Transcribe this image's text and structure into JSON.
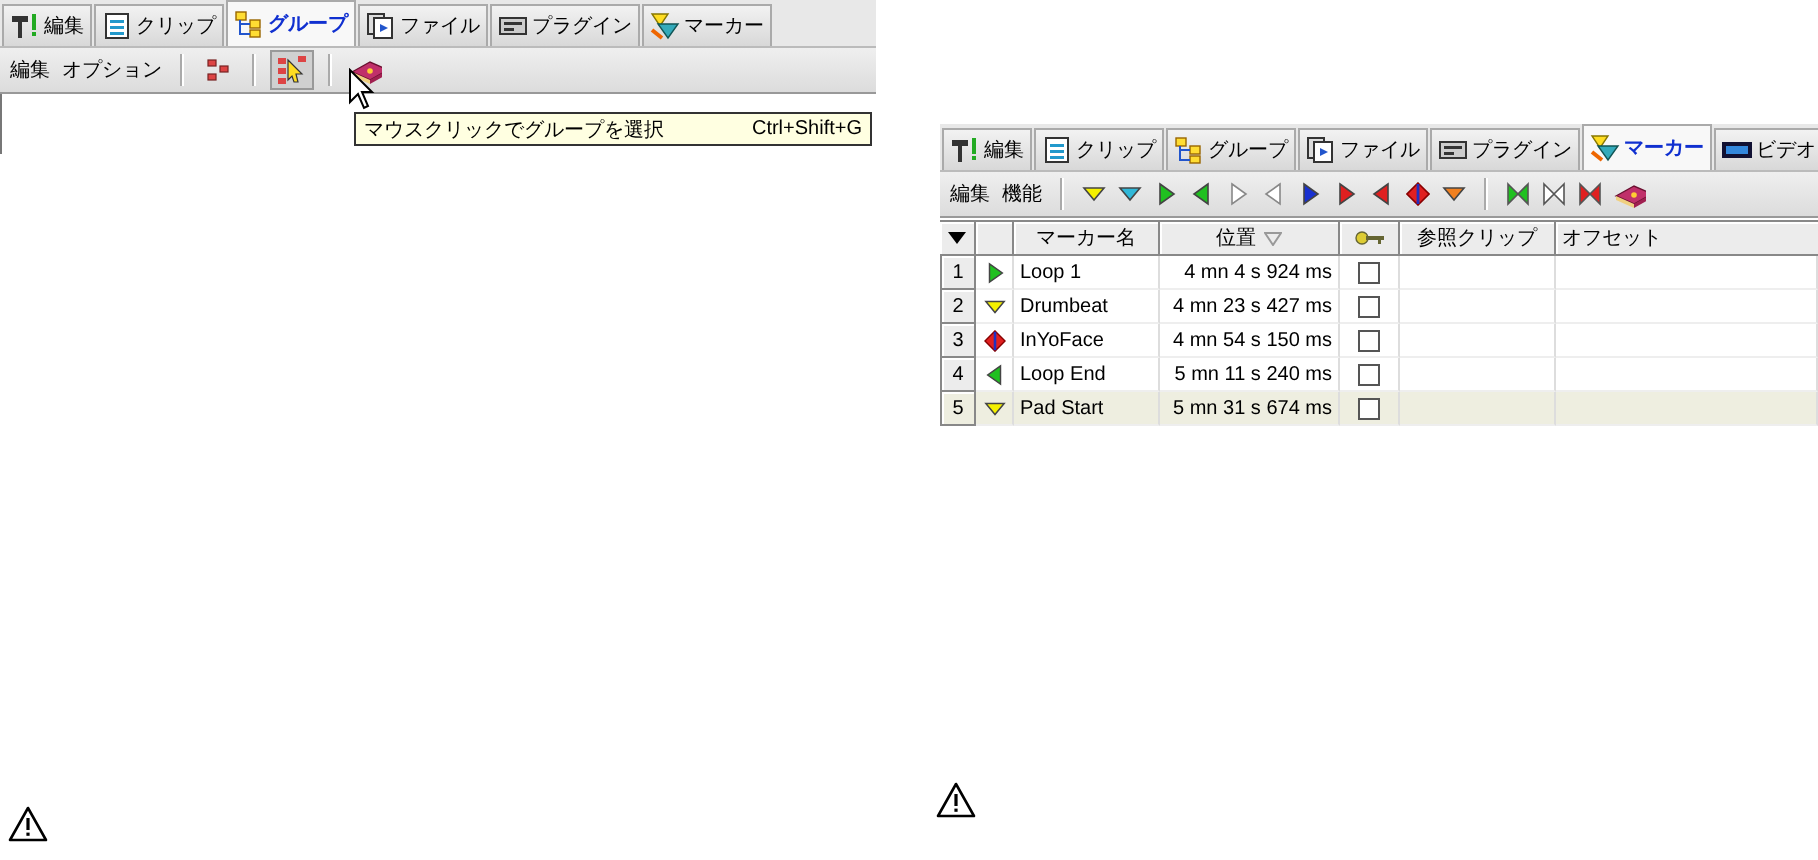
{
  "group_panel": {
    "tabs": [
      {
        "label": "編集",
        "kind": "hammer",
        "selected": false
      },
      {
        "label": "クリップ",
        "kind": "list",
        "selected": false
      },
      {
        "label": "グループ",
        "kind": "group",
        "selected": true
      },
      {
        "label": "ファイル",
        "kind": "file",
        "selected": false
      },
      {
        "label": "プラグイン",
        "kind": "plugin",
        "selected": false
      },
      {
        "label": "マーカー",
        "kind": "marker",
        "selected": false
      }
    ],
    "menu": [
      "編集",
      "オプション"
    ],
    "tools": [
      {
        "kind": "separator"
      },
      {
        "kind": "group",
        "pressed": false
      },
      {
        "kind": "separator"
      },
      {
        "kind": "group-select",
        "pressed": true
      },
      {
        "kind": "separator"
      },
      {
        "kind": "help",
        "pressed": false
      }
    ],
    "tooltip": {
      "text": "マウスクリックでグループを選択",
      "shortcut": "Ctrl+Shift+G"
    }
  },
  "marker_panel": {
    "tabs": [
      {
        "label": "編集",
        "kind": "hammer",
        "selected": false
      },
      {
        "label": "クリップ",
        "kind": "list",
        "selected": false
      },
      {
        "label": "グループ",
        "kind": "group",
        "selected": false
      },
      {
        "label": "ファイル",
        "kind": "file",
        "selected": false
      },
      {
        "label": "プラグイン",
        "kind": "plugin",
        "selected": false
      },
      {
        "label": "マーカー",
        "kind": "marker",
        "selected": true
      },
      {
        "label": "ビデオ",
        "kind": "film",
        "selected": false
      }
    ],
    "menu": [
      "編集",
      "機能"
    ],
    "tools": [
      {
        "kind": "separator"
      },
      {
        "kind": "down",
        "color": "#f4f000"
      },
      {
        "kind": "down",
        "color": "#30b8d8"
      },
      {
        "kind": "right",
        "color": "#20c020"
      },
      {
        "kind": "left",
        "color": "#20c020"
      },
      {
        "kind": "right-outline",
        "color": "#ffffff"
      },
      {
        "kind": "left-outline",
        "color": "#ffffff"
      },
      {
        "kind": "right",
        "color": "#1830d0"
      },
      {
        "kind": "right",
        "color": "#e02020"
      },
      {
        "kind": "left",
        "color": "#e02020"
      },
      {
        "kind": "diamond",
        "color": "#e02020"
      },
      {
        "kind": "down",
        "color": "#f08020"
      },
      {
        "kind": "separator"
      },
      {
        "kind": "bowtie",
        "color": "#20c020"
      },
      {
        "kind": "bowtie",
        "color": "#ffffff"
      },
      {
        "kind": "bowtie",
        "color": "#e02020"
      },
      {
        "kind": "help",
        "pressed": false
      }
    ],
    "table": {
      "columns": [
        "マーカー名",
        "位置",
        "参照クリップ",
        "オフセット"
      ],
      "rows": [
        {
          "number": "1",
          "kind": "right",
          "color": "#20c020",
          "name": "Loop 1",
          "position": "4 mn 4 s 924 ms",
          "locked": false,
          "selected": false
        },
        {
          "number": "2",
          "kind": "down",
          "color": "#f4f000",
          "name": "Drumbeat",
          "position": "4 mn 23 s 427 ms",
          "locked": false,
          "selected": false
        },
        {
          "number": "3",
          "kind": "diamond",
          "color": "#e02020",
          "name": "InYoFace",
          "position": "4 mn 54 s 150 ms",
          "locked": false,
          "selected": false
        },
        {
          "number": "4",
          "kind": "left",
          "color": "#20c020",
          "name": "Loop End",
          "position": "5 mn 11 s 240 ms",
          "locked": false,
          "selected": false
        },
        {
          "number": "5",
          "kind": "down",
          "color": "#f4f000",
          "name": "Pad Start",
          "position": "5 mn 31 s 674 ms",
          "locked": false,
          "selected": true
        }
      ]
    }
  }
}
